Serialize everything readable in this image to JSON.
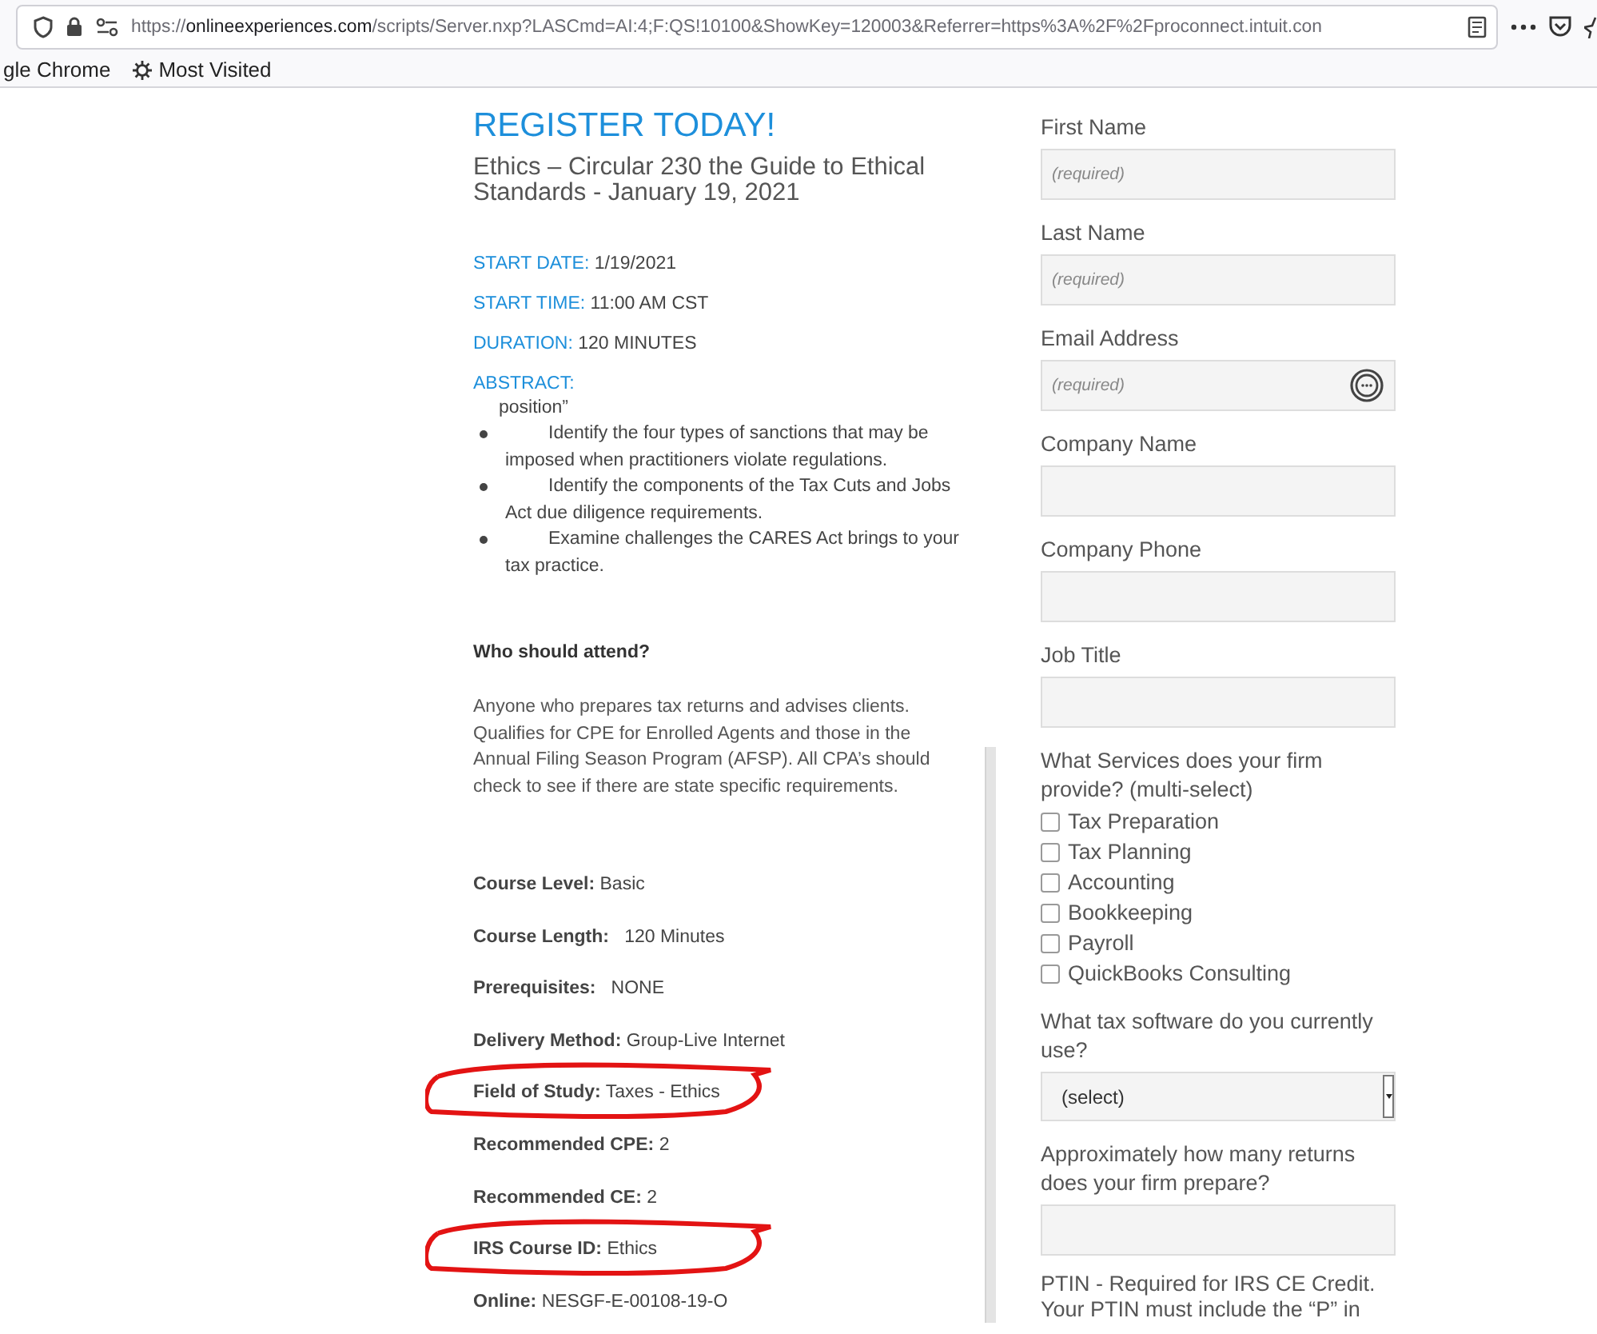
{
  "browser": {
    "url_scheme": "https://",
    "url_host": "onlineexperiences.com",
    "url_path": "/scripts/Server.nxp?LASCmd=AI:4;F:QS!10100&ShowKey=120003&Referrer=https%3A%2F%2Fproconnect.intuit.con",
    "bookmarks": [
      {
        "kind": "plain",
        "label": "gle Chrome"
      },
      {
        "kind": "gear",
        "label": "Most Visited"
      }
    ]
  },
  "event": {
    "heading": "REGISTER TODAY!",
    "title": "Ethics – Circular 230 the Guide to Ethical Standards - January 19, 2021",
    "meta": [
      {
        "label": "START DATE:",
        "value": "1/19/2021"
      },
      {
        "label": "START TIME:",
        "value": "11:00 AM CST"
      },
      {
        "label": "DURATION:",
        "value": "120 MINUTES"
      }
    ],
    "abstract_label": "ABSTRACT:",
    "abstract_fragment": "position”",
    "abstract_bullets": [
      "Identify the four types of sanctions that may be imposed when practitioners violate regulations.",
      "Identify the components of the Tax Cuts and Jobs Act due diligence requirements.",
      "Examine challenges the CARES Act brings to your tax practice."
    ],
    "audience_heading": "Who should attend?",
    "audience_text": "Anyone who prepares tax returns and advises clients. Qualifies for CPE for Enrolled Agents and those in the Annual Filing Season Program (AFSP). All CPA’s should check to see if there are state specific requirements.",
    "details": [
      {
        "label": "Course Level:",
        "value": "Basic",
        "circled": false
      },
      {
        "label": "Course Length:",
        "value": "  120 Minutes",
        "circled": false
      },
      {
        "label": "Prerequisites:",
        "value": "  NONE",
        "circled": false
      },
      {
        "label": "Delivery Method:",
        "value": "Group-Live Internet",
        "circled": false
      },
      {
        "label": "Field of Study:",
        "value": "Taxes - Ethics",
        "circled": true
      },
      {
        "label": "Recommended CPE:",
        "value": "2",
        "circled": false
      },
      {
        "label": "Recommended CE:",
        "value": "2",
        "circled": false
      },
      {
        "label": "IRS Course ID:",
        "value": "Ethics",
        "circled": true
      },
      {
        "label": "Online:",
        "value": "NESGF-E-00108-19-O",
        "circled": false
      }
    ]
  },
  "form": [
    {
      "kind": "text",
      "label": "First Name",
      "placeholder": "(required)"
    },
    {
      "kind": "text",
      "label": "Last Name",
      "placeholder": "(required)"
    },
    {
      "kind": "text",
      "label": "Email Address",
      "placeholder": "(required)",
      "autofill_icon": true
    },
    {
      "kind": "text",
      "label": "Company Name"
    },
    {
      "kind": "text",
      "label": "Company Phone"
    },
    {
      "kind": "text",
      "label": "Job Title"
    },
    {
      "kind": "checks",
      "label": "What Services does your firm provide? (multi-select)",
      "options": [
        {
          "label": "Tax Preparation",
          "checked": false
        },
        {
          "label": "Tax Planning",
          "checked": false
        },
        {
          "label": "Accounting",
          "checked": false
        },
        {
          "label": "Bookkeeping",
          "checked": false
        },
        {
          "label": "Payroll",
          "checked": false
        },
        {
          "label": "QuickBooks Consulting",
          "checked": false
        }
      ]
    },
    {
      "kind": "select",
      "label": "What tax software do you currently use?",
      "value": "(select)"
    },
    {
      "kind": "text",
      "label": "Approximately how many returns does your firm prepare?"
    },
    {
      "kind": "note",
      "label": "PTIN - Required for IRS CE Credit. Your PTIN must include the “P” in"
    }
  ]
}
